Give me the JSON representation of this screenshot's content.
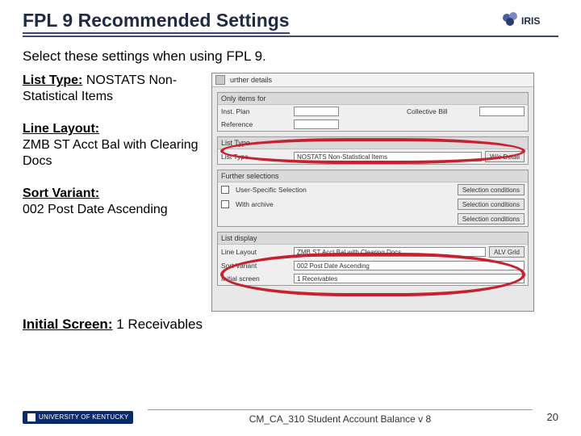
{
  "header": {
    "title": "FPL 9 Recommended Settings",
    "logo_text": "IRIS"
  },
  "subhead": "Select these settings when using FPL 9.",
  "settings": {
    "list_type": {
      "label": "List Type",
      "value": "NOSTATS Non-Statistical Items"
    },
    "line_layout": {
      "label": "Line Layout",
      "value": "ZMB ST Acct Bal with Clearing Docs"
    },
    "sort_variant": {
      "label": "Sort Variant",
      "value": "002 Post Date Ascending"
    },
    "initial_screen": {
      "label": "Initial Screen",
      "value": "1 Receivables"
    }
  },
  "screenshot": {
    "top_label": "urther details",
    "panel1": {
      "title": "Only items for",
      "rows": [
        {
          "label": "Inst. Plan",
          "right": "Collective Bill"
        },
        {
          "label": "Reference"
        }
      ]
    },
    "panel2": {
      "title": "List Type",
      "row": {
        "label": "List Type",
        "value": "NOSTATS Non-Statistical Items",
        "button": "W/o Detail"
      }
    },
    "panel3": {
      "title": "Further selections",
      "rows": [
        {
          "check_label": "User-Specific Selection",
          "button": "Selection conditions"
        },
        {
          "check_label": "With archive",
          "button2": "Selection conditions",
          "button3": "Selection conditions"
        }
      ]
    },
    "panel4": {
      "title": "List display",
      "rows": [
        {
          "label": "Line Layout",
          "value": "ZMB ST Acct Bal with Clearing Docs",
          "button": "ALV Grid"
        },
        {
          "label": "Sort Variant",
          "value": "002 Post Date Ascending"
        },
        {
          "label": "Initial screen",
          "value": "1 Receivables"
        }
      ]
    }
  },
  "footer": {
    "uk": "UNIVERSITY OF KENTUCKY",
    "doc": "CM_CA_310 Student Account Balance v 8",
    "page": "20"
  }
}
